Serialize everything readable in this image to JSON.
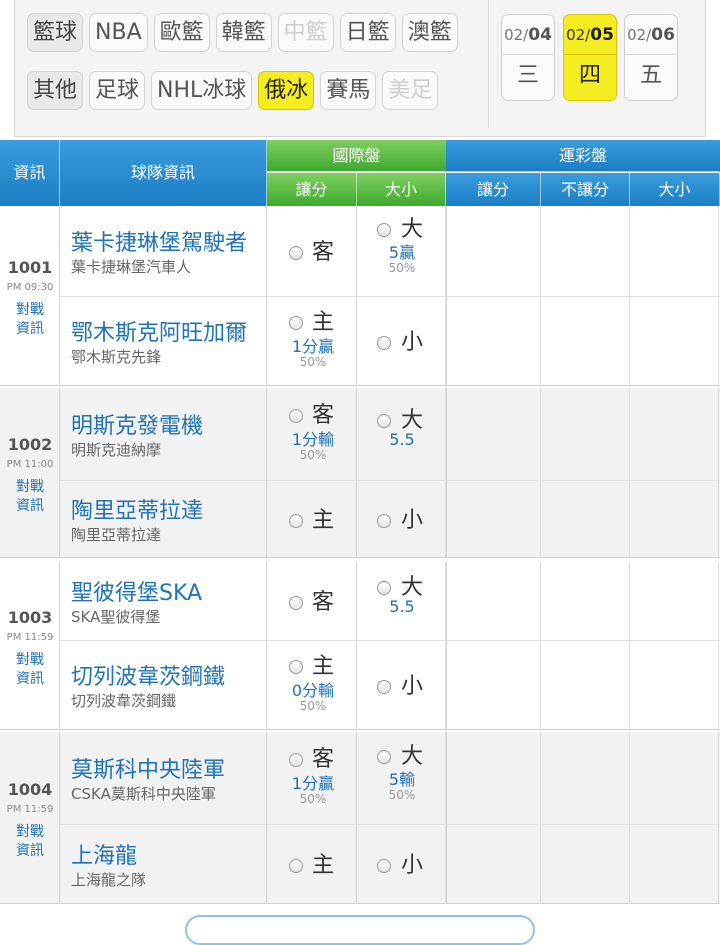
{
  "categories": {
    "row1": [
      {
        "label": "籃球",
        "state": "lead"
      },
      {
        "label": "NBA",
        "state": "normal"
      },
      {
        "label": "歐籃",
        "state": "normal"
      },
      {
        "label": "韓籃",
        "state": "normal"
      },
      {
        "label": "中籃",
        "state": "disabled"
      },
      {
        "label": "日籃",
        "state": "normal"
      },
      {
        "label": "澳籃",
        "state": "normal"
      }
    ],
    "row2": [
      {
        "label": "其他",
        "state": "lead"
      },
      {
        "label": "足球",
        "state": "normal"
      },
      {
        "label": "NHL冰球",
        "state": "normal"
      },
      {
        "label": "俄冰",
        "state": "active"
      },
      {
        "label": "賽馬",
        "state": "normal"
      },
      {
        "label": "美足",
        "state": "disabled"
      }
    ]
  },
  "dates": [
    {
      "month": "02/",
      "day": "04",
      "weekday": "三",
      "active": false
    },
    {
      "month": "02/",
      "day": "05",
      "weekday": "四",
      "active": true
    },
    {
      "month": "02/",
      "day": "06",
      "weekday": "五",
      "active": false
    }
  ],
  "header": {
    "info": "資訊",
    "team_info": "球隊資訊",
    "intl_group": "國際盤",
    "intl_spread": "讓分",
    "intl_total": "大小",
    "lottery_group": "運彩盤",
    "lottery_spread": "讓分",
    "lottery_nospread": "不讓分",
    "lottery_total": "大小"
  },
  "games": [
    {
      "number": "1001",
      "time": "PM 09:30",
      "vs_label_1": "對戰",
      "vs_label_2": "資訊",
      "away": {
        "name": "葉卡捷琳堡駕駛者",
        "subname": "葉卡捷琳堡汽車人",
        "side": "客",
        "spread": "",
        "spread_pct": "",
        "total_side": "大",
        "total": "5贏",
        "total_pct": "50%"
      },
      "home": {
        "name": "鄂木斯克阿旺加爾",
        "subname": "鄂木斯克先鋒",
        "side": "主",
        "spread": "1分贏",
        "spread_pct": "50%",
        "total_side": "小",
        "total": "",
        "total_pct": ""
      }
    },
    {
      "number": "1002",
      "time": "PM 11:00",
      "vs_label_1": "對戰",
      "vs_label_2": "資訊",
      "away": {
        "name": "明斯克發電機",
        "subname": "明斯克迪納摩",
        "side": "客",
        "spread": "1分輸",
        "spread_pct": "50%",
        "total_side": "大",
        "total": "5.5",
        "total_pct": ""
      },
      "home": {
        "name": "陶里亞蒂拉達",
        "subname": "陶里亞蒂拉達",
        "side": "主",
        "spread": "",
        "spread_pct": "",
        "total_side": "小",
        "total": "",
        "total_pct": ""
      }
    },
    {
      "number": "1003",
      "time": "PM 11:59",
      "vs_label_1": "對戰",
      "vs_label_2": "資訊",
      "away": {
        "name": "聖彼得堡SKA",
        "subname": "SKA聖彼得堡",
        "side": "客",
        "spread": "",
        "spread_pct": "",
        "total_side": "大",
        "total": "5.5",
        "total_pct": ""
      },
      "home": {
        "name": "切列波韋茨鋼鐵",
        "subname": "切列波韋茨鋼鐵",
        "side": "主",
        "spread": "0分輸",
        "spread_pct": "50%",
        "total_side": "小",
        "total": "",
        "total_pct": ""
      }
    },
    {
      "number": "1004",
      "time": "PM 11:59",
      "vs_label_1": "對戰",
      "vs_label_2": "資訊",
      "away": {
        "name": "莫斯科中央陸軍",
        "subname": "CSKA莫斯科中央陸軍",
        "side": "客",
        "spread": "1分贏",
        "spread_pct": "50%",
        "total_side": "大",
        "total": "5輸",
        "total_pct": "50%"
      },
      "home": {
        "name": "上海龍",
        "subname": "上海龍之隊",
        "side": "主",
        "spread": "",
        "spread_pct": "",
        "total_side": "小",
        "total": "",
        "total_pct": ""
      }
    }
  ],
  "colors": {
    "accent": "#1f73b7",
    "active": "#f6ec22",
    "header_blue": "#1c7ec4",
    "header_green": "#3ea92f"
  }
}
